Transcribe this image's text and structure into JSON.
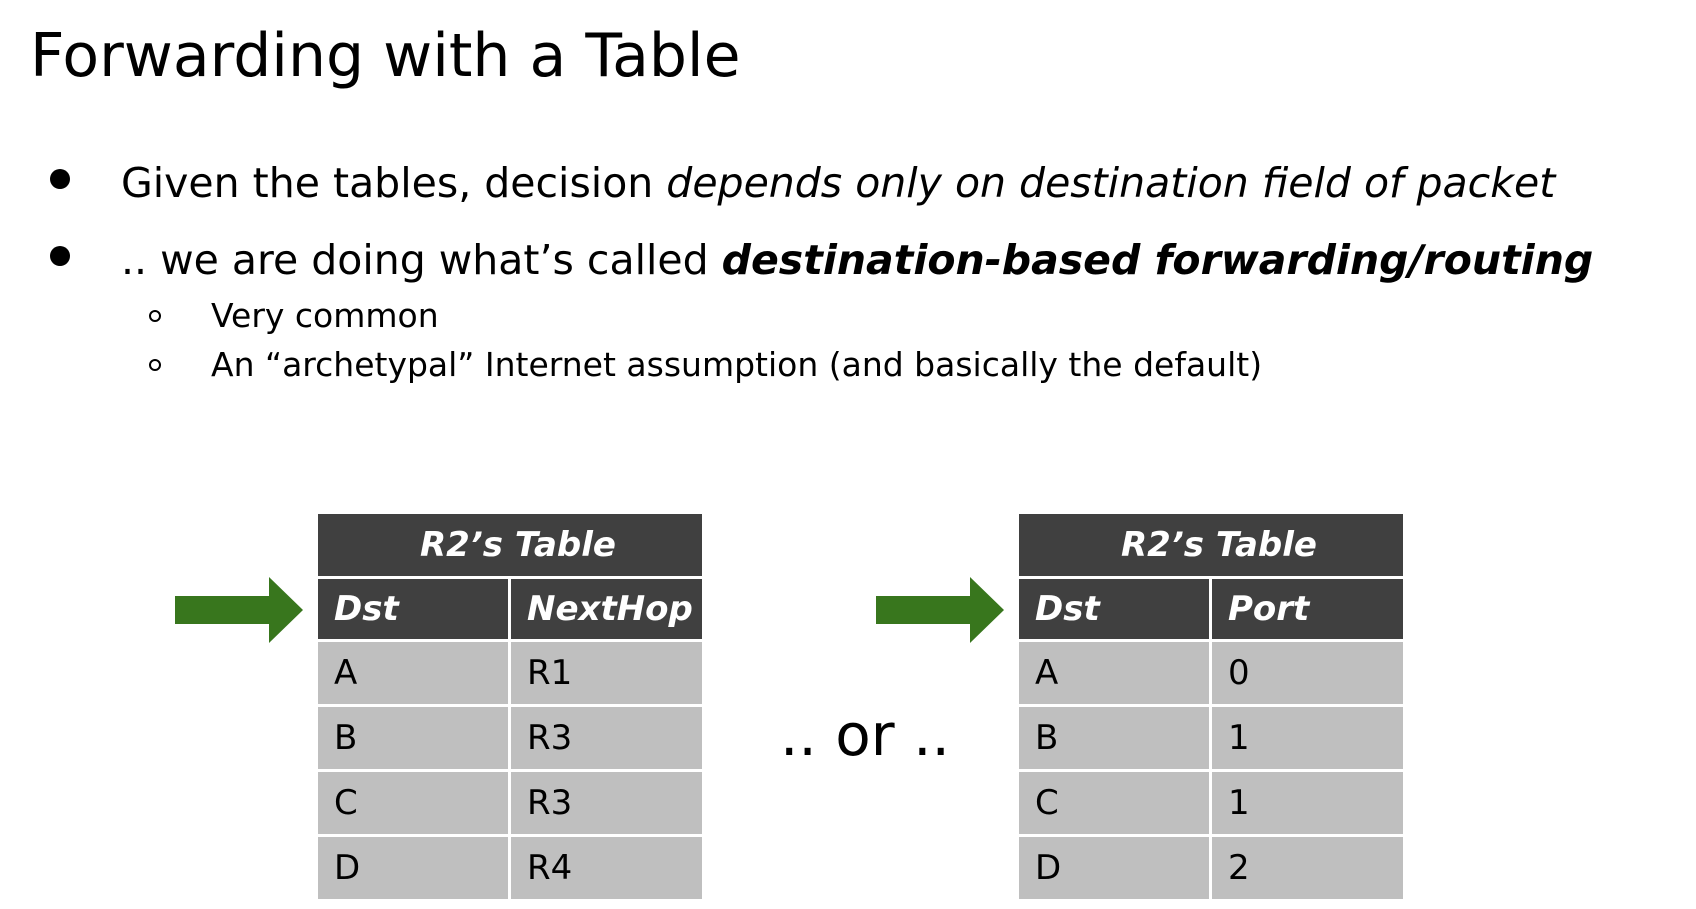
{
  "slide": {
    "title": "Forwarding with a Table"
  },
  "bullets": [
    {
      "plain": "Given the tables, decision ",
      "emphasis": "depends only on destination field of packet"
    },
    {
      "plain": ".. we are doing what’s called ",
      "emphasis": "destination-based forwarding/routing"
    }
  ],
  "sub_bullets": [
    "Very common",
    "An “archetypal” Internet assumption (and basically the default)"
  ],
  "tables": [
    {
      "caption": "R2’s Table",
      "headers": [
        "Dst",
        "NextHop"
      ],
      "rows": [
        [
          "A",
          "R1"
        ],
        [
          "B",
          "R3"
        ],
        [
          "C",
          "R3"
        ],
        [
          "D",
          "R4"
        ]
      ]
    },
    {
      "caption": "R2’s Table",
      "headers": [
        "Dst",
        "Port"
      ],
      "rows": [
        [
          "A",
          "0"
        ],
        [
          "B",
          "1"
        ],
        [
          "C",
          "1"
        ],
        [
          "D",
          "2"
        ]
      ]
    }
  ],
  "separator_text": ".. or ..",
  "colors": {
    "header_bg": "#404040",
    "cell_bg": "#bfbfbf",
    "arrow": "#38761d"
  },
  "icons": {
    "arrow": "right-arrow-icon"
  }
}
